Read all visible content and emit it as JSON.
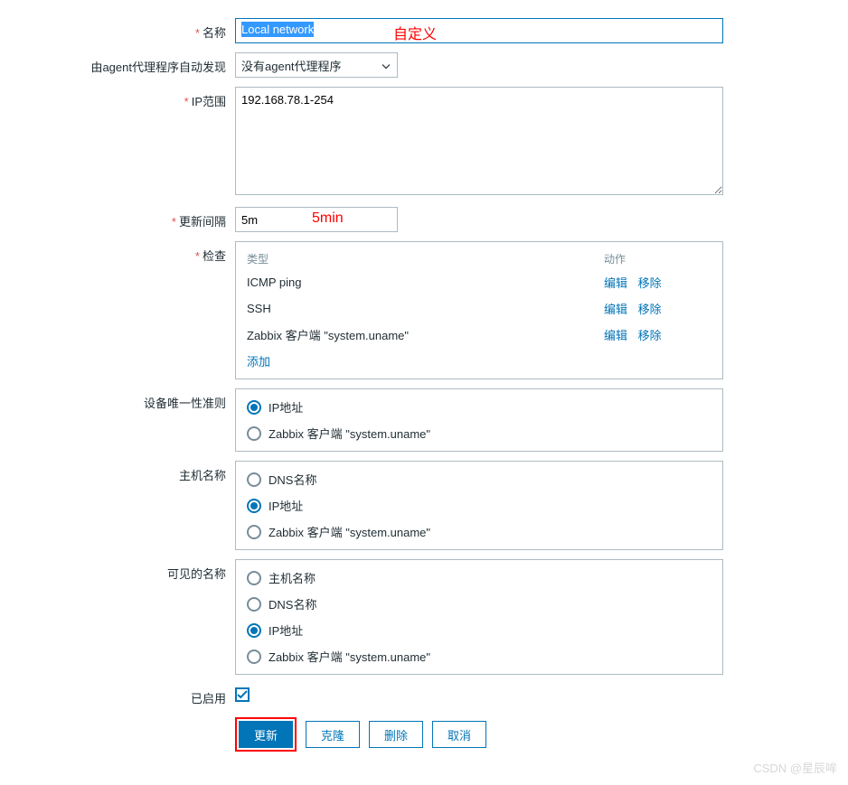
{
  "labels": {
    "name": "名称",
    "proxy": "由agent代理程序自动发现",
    "ip_range": "IP范围",
    "interval": "更新间隔",
    "checks": "检查",
    "uniqueness": "设备唯一性准则",
    "host_name": "主机名称",
    "visible_name": "可见的名称",
    "enabled": "已启用"
  },
  "name_value": "Local network",
  "proxy_value": "没有agent代理程序",
  "ip_range_value": "192.168.78.1-254",
  "interval_value": "5m",
  "checks": {
    "head_type": "类型",
    "head_action": "动作",
    "rows": [
      {
        "type": "ICMP ping"
      },
      {
        "type": "SSH"
      },
      {
        "type": "Zabbix 客户端 \"system.uname\""
      }
    ],
    "action_edit": "编辑",
    "action_remove": "移除",
    "add": "添加"
  },
  "uniqueness_options": {
    "ip": "IP地址",
    "zabbix": "Zabbix 客户端 \"system.uname\""
  },
  "hostname_options": {
    "dns": "DNS名称",
    "ip": "IP地址",
    "zabbix": "Zabbix 客户端 \"system.uname\""
  },
  "visible_options": {
    "host": "主机名称",
    "dns": "DNS名称",
    "ip": "IP地址",
    "zabbix": "Zabbix 客户端 \"system.uname\""
  },
  "buttons": {
    "update": "更新",
    "clone": "克隆",
    "delete": "删除",
    "cancel": "取消"
  },
  "annotations": {
    "custom": "自定义",
    "five_min": "5min"
  },
  "watermark": "CSDN @星辰哞"
}
